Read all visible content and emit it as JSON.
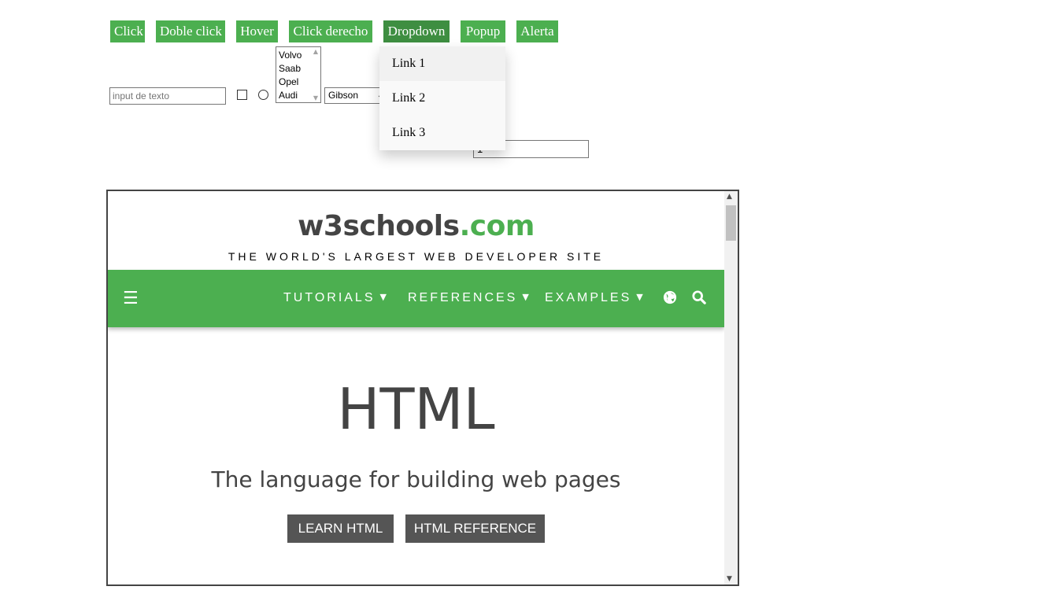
{
  "toolbar": {
    "buttons": [
      {
        "label": "Click"
      },
      {
        "label": "Doble click"
      },
      {
        "label": "Hover"
      },
      {
        "label": "Click derecho"
      },
      {
        "label": "Dropdown"
      },
      {
        "label": "Popup"
      },
      {
        "label": "Alerta"
      }
    ]
  },
  "form": {
    "text_input_placeholder": "input de texto",
    "listbox_options": [
      "Volvo",
      "Saab",
      "Opel",
      "Audi"
    ],
    "select_value": "Gibson",
    "number_value": "1"
  },
  "dropdown": {
    "links": [
      "Link 1",
      "Link 2",
      "Link 3"
    ]
  },
  "iframe": {
    "logo_main": "w3schools",
    "logo_suffix": ".com",
    "tagline": "THE WORLD'S LARGEST WEB DEVELOPER SITE",
    "nav": {
      "menu_icon": "☰",
      "items": [
        "TUTORIALS",
        "REFERENCES",
        "EXAMPLES"
      ],
      "caret": "▼",
      "icons": [
        "globe-icon",
        "search-icon"
      ]
    },
    "hero": {
      "title": "HTML",
      "subtitle": "The language for building web pages",
      "buttons": [
        "LEARN HTML",
        "HTML REFERENCE"
      ]
    }
  },
  "colors": {
    "button_green": "#4caf50",
    "button_green_active": "#3e8e41",
    "hero_button": "#555555",
    "logo_text": "#444444"
  }
}
